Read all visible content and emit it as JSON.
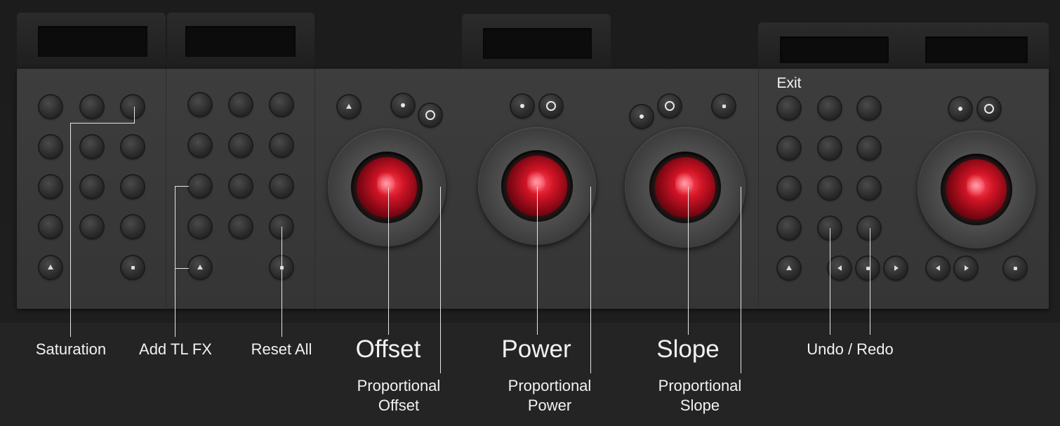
{
  "labels": {
    "saturation": "Saturation",
    "add_tl_fx": "Add TL FX",
    "reset_all": "Reset All",
    "offset": "Offset",
    "power": "Power",
    "slope": "Slope",
    "proportional_offset_1": "Proportional",
    "proportional_offset_2": "Offset",
    "proportional_power_1": "Proportional",
    "proportional_power_2": "Power",
    "proportional_slope_1": "Proportional",
    "proportional_slope_2": "Slope",
    "undo_redo": "Undo / Redo",
    "exit": "Exit"
  },
  "colors": {
    "background": "#242424",
    "panel": "#3a3a3a",
    "trackball": "#d01425",
    "label_text": "#f2f2f2"
  }
}
